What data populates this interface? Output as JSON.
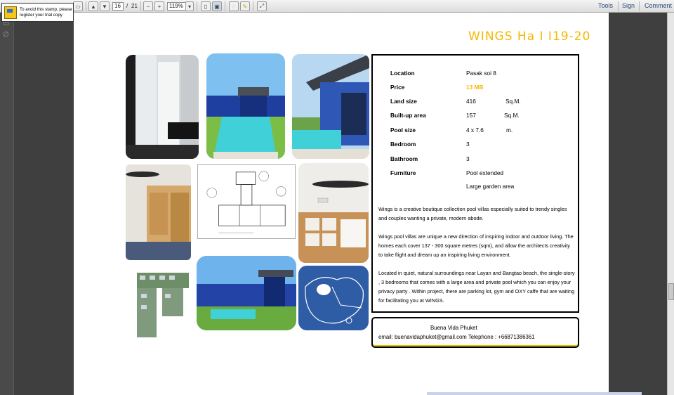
{
  "toolbar": {
    "page_current": "16",
    "page_separator": "/",
    "page_total": "21",
    "zoom": "119%",
    "tools_label": "Tools",
    "sign_label": "Sign",
    "comment_label": "Comment"
  },
  "stamp_notice": {
    "line1": "To avoid this stamp, please",
    "line2": "register your trial copy"
  },
  "document": {
    "title": "WINGS Ha I I19-20",
    "details": [
      {
        "label": "Location",
        "value": "Pasak soi 8",
        "unit": ""
      },
      {
        "label": "Price",
        "value": "13 MB",
        "unit": ""
      },
      {
        "label": "Land size",
        "value": "416",
        "unit": "Sq.M."
      },
      {
        "label": "Built-up area",
        "value": "157",
        "unit": "Sq.M."
      },
      {
        "label": "Pool size",
        "value": "4 x 7.6",
        "unit": "m."
      },
      {
        "label": "Bedroom",
        "value": "3",
        "unit": ""
      },
      {
        "label": "Bathroom",
        "value": "3",
        "unit": ""
      },
      {
        "label": "Furniture",
        "value": "Pool extended",
        "unit": ""
      },
      {
        "label": "",
        "value": "Large garden area",
        "unit": ""
      }
    ],
    "paragraphs": [
      "Wings is a creative boutique collection pool villas especially suited to trendy singles and couples wanting a private, modern abode.",
      "Wings pool villas are unique a new direction of inspiring indoor and outdoor living. The homes each cover 137 - 300 square metres (sqm), and allow the architects creativity to take flight and dream up an inspiring living environment.",
      "Located in quiet, natural surroundings near Layan and Bangtao beach, the single-story , 3 bedrooms  that comes with a large area and private pool which you can enjoy your privacy party . Within project, there are parking lot, gym and OXY caffe that are waiting for facilitating you at WINGS."
    ],
    "contact": {
      "name": "Buena Vida Phuket",
      "line": "email: buenavidaphuket@gmail.com    Telephone : +66871386361"
    }
  },
  "colors": {
    "accent": "#f5b800",
    "wall_blue": "#2f57b5",
    "pool": "#3fd0d8"
  }
}
